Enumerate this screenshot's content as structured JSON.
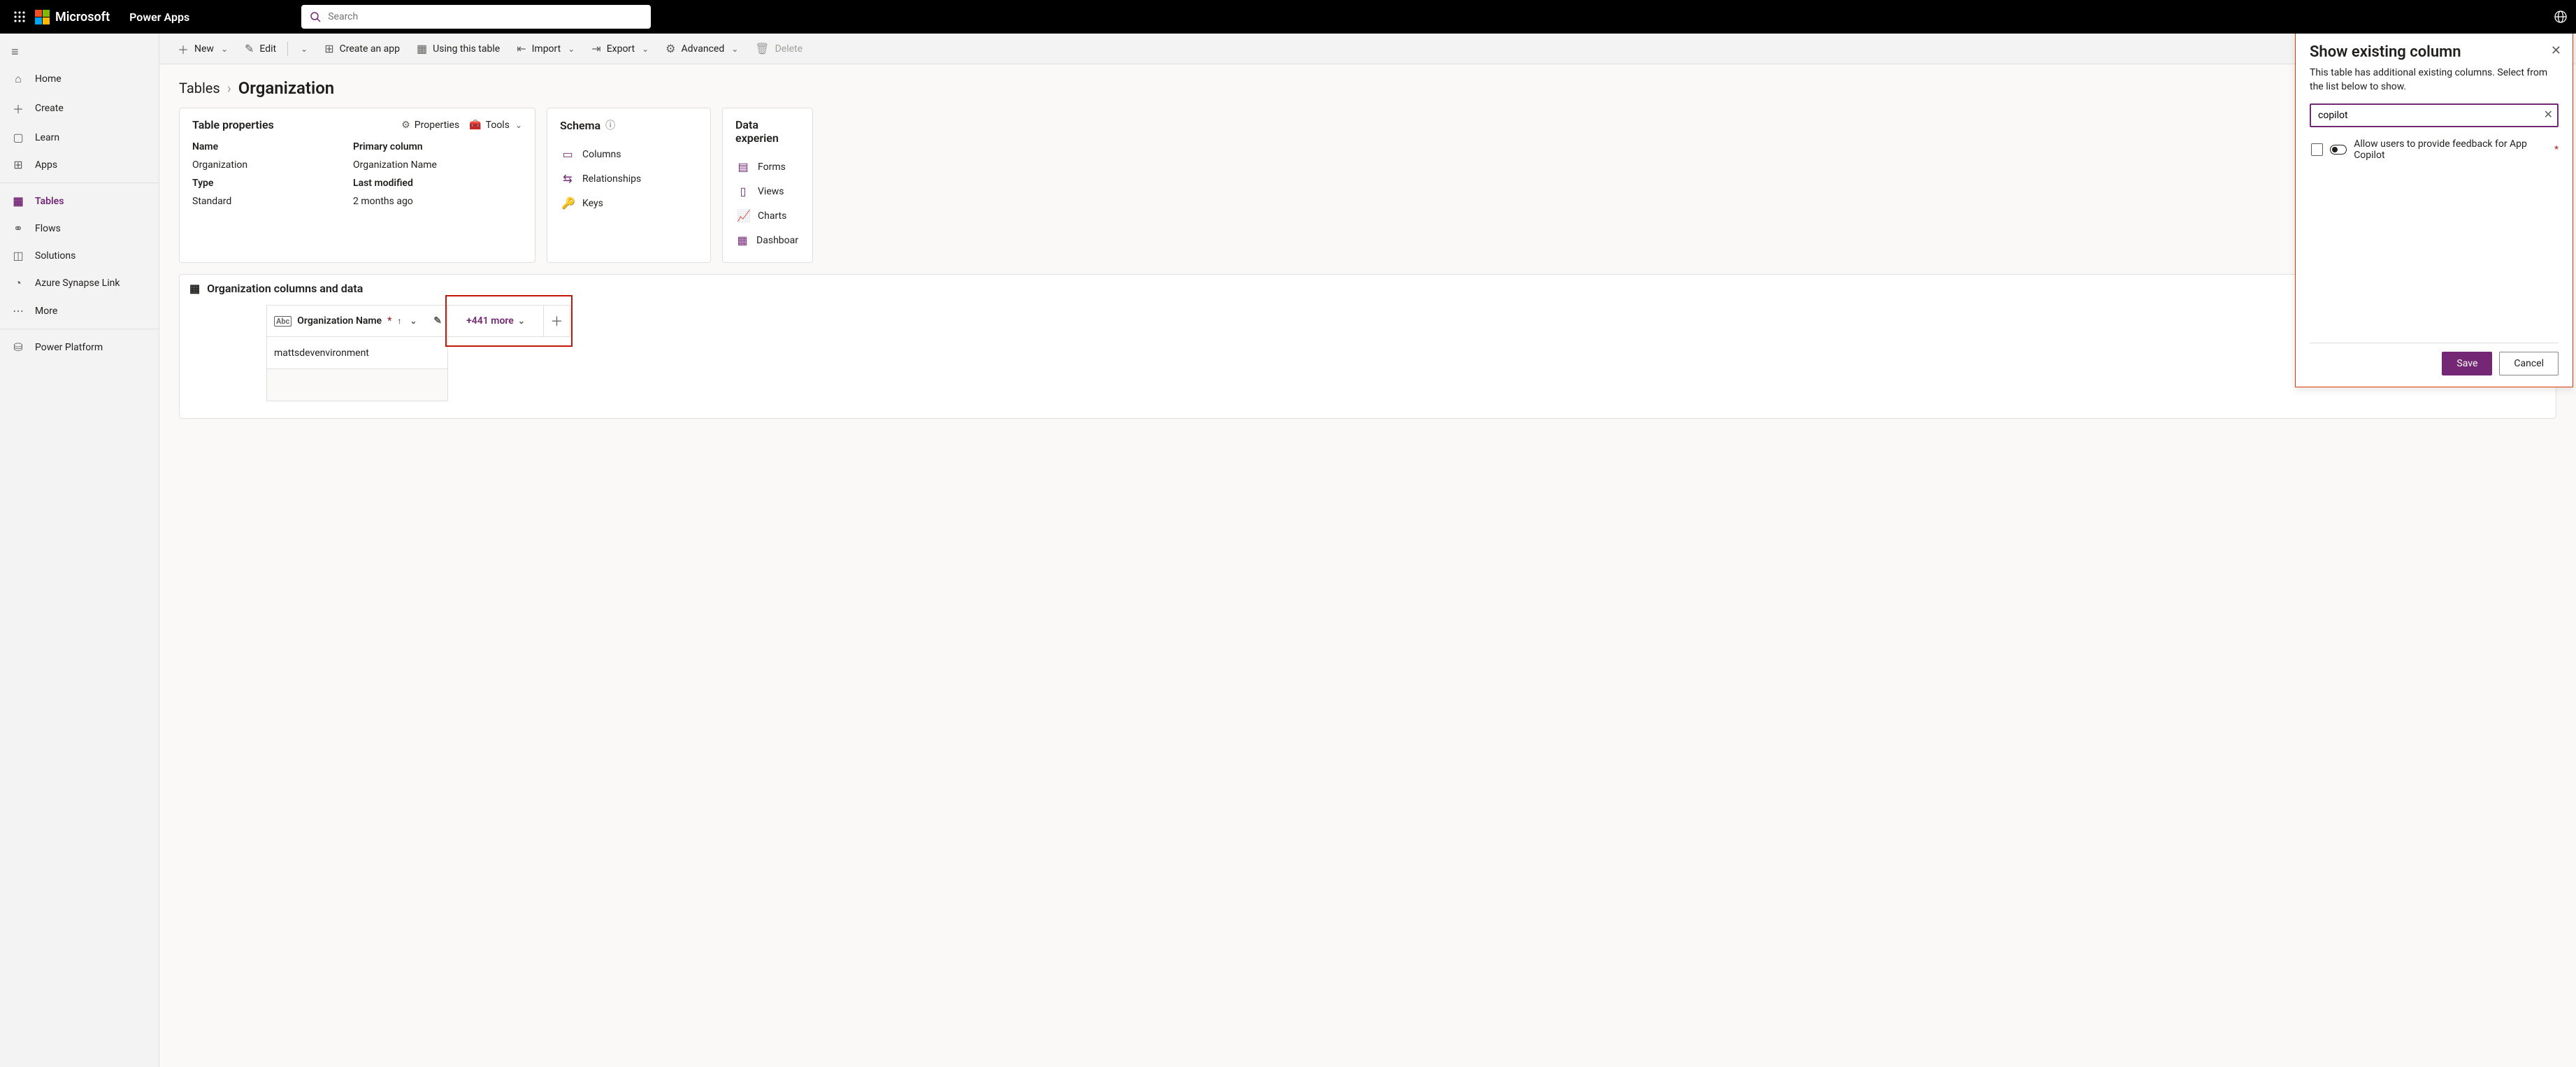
{
  "topbar": {
    "brand": "Microsoft",
    "app": "Power Apps",
    "search_placeholder": "Search"
  },
  "rail": {
    "items": [
      {
        "icon": "⌂",
        "label": "Home"
      },
      {
        "icon": "＋",
        "label": "Create"
      },
      {
        "icon": "▢",
        "label": "Learn"
      },
      {
        "icon": "⊞",
        "label": "Apps"
      },
      {
        "icon": "▦",
        "label": "Tables",
        "active": true
      },
      {
        "icon": "⚭",
        "label": "Flows"
      },
      {
        "icon": "◫",
        "label": "Solutions"
      },
      {
        "icon": "◔",
        "label": "Azure Synapse Link"
      },
      {
        "icon": "⋯",
        "label": "More"
      },
      {
        "icon": "⛁",
        "label": "Power Platform"
      }
    ]
  },
  "cmdbar": {
    "new": "New",
    "edit": "Edit",
    "create_app": "Create an app",
    "using_table": "Using this table",
    "import": "Import",
    "export": "Export",
    "advanced": "Advanced",
    "delete": "Delete"
  },
  "breadcrumb": {
    "root": "Tables",
    "current": "Organization"
  },
  "card_props": {
    "title": "Table properties",
    "properties_link": "Properties",
    "tools_link": "Tools",
    "name_lab": "Name",
    "name_val": "Organization",
    "primary_lab": "Primary column",
    "primary_val": "Organization Name",
    "type_lab": "Type",
    "type_val": "Standard",
    "modified_lab": "Last modified",
    "modified_val": "2 months ago"
  },
  "card_schema": {
    "title": "Schema",
    "columns": "Columns",
    "relationships": "Relationships",
    "keys": "Keys"
  },
  "card_dx": {
    "title": "Data experien",
    "forms": "Forms",
    "views": "Views",
    "charts": "Charts",
    "dash": "Dashboar"
  },
  "grid": {
    "title": "Organization columns and data",
    "col1": "Organization Name",
    "more_label": "+441 more",
    "row1": "mattsdevenvironment"
  },
  "flyout": {
    "title": "Show existing column",
    "body": "This table has additional existing columns. Select from the list below to show.",
    "search_value": "copilot",
    "result": "Allow users to provide feedback for App Copilot",
    "save": "Save",
    "cancel": "Cancel"
  }
}
